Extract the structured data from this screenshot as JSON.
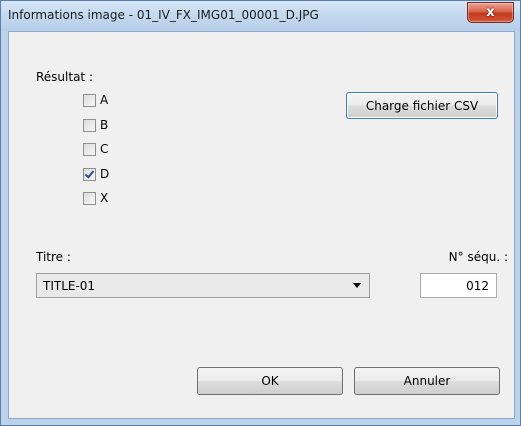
{
  "window": {
    "title": "Informations image - 01_IV_FX_IMG01_00001_D.JPG",
    "close_symbol": "x"
  },
  "result": {
    "label": "Résultat :",
    "options": [
      {
        "label": "A",
        "checked": false
      },
      {
        "label": "B",
        "checked": false
      },
      {
        "label": "C",
        "checked": false
      },
      {
        "label": "D",
        "checked": true
      },
      {
        "label": "X",
        "checked": false
      }
    ]
  },
  "csv_button_label": "Charge fichier CSV",
  "titre": {
    "label": "Titre :",
    "selected": "TITLE-01"
  },
  "sequence": {
    "label": "N° séqu. :",
    "value": "012"
  },
  "buttons": {
    "ok": "OK",
    "cancel": "Annuler"
  }
}
